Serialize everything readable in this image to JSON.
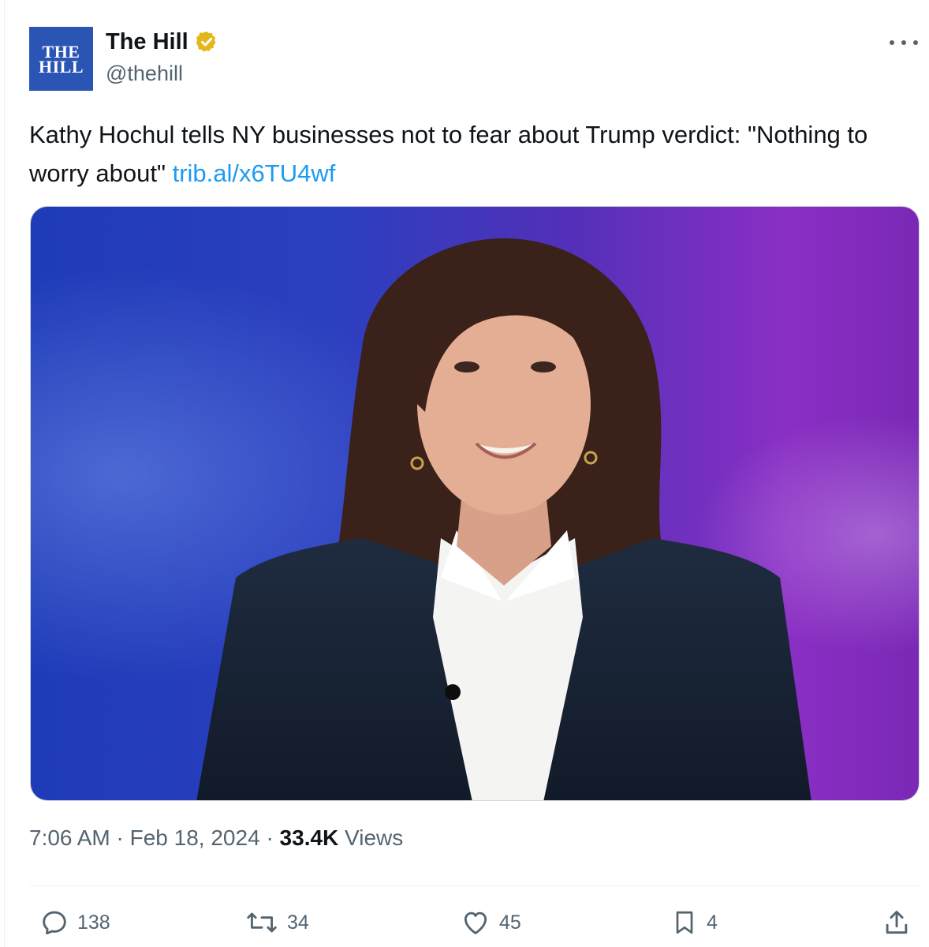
{
  "author": {
    "avatar_text_line1": "THE",
    "avatar_text_line2": "HILL",
    "display_name": "The Hill",
    "handle": "@thehill",
    "verified_badge_color": "#e2b719"
  },
  "tweet": {
    "text": "Kathy Hochul tells NY businesses not to fear about Trump verdict: \"Nothing to worry about\" ",
    "link_text": "trib.al/x6TU4wf"
  },
  "media": {
    "description_icon": "photo-of-woman-speaking"
  },
  "meta": {
    "time": "7:06 AM",
    "separator": "·",
    "date": "Feb 18, 2024",
    "views_count": "33.4K",
    "views_label": "Views"
  },
  "actions": {
    "replies": "138",
    "reposts": "34",
    "likes": "45",
    "bookmarks": "4"
  },
  "colors": {
    "link": "#1d9bf0",
    "muted": "#536471",
    "brand_avatar": "#2b55b5"
  }
}
